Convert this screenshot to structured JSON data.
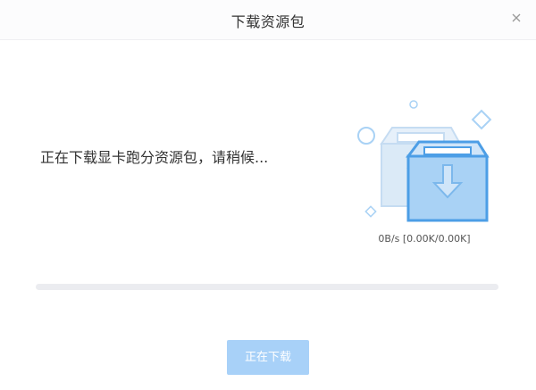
{
  "dialog": {
    "title": "下载资源包",
    "close_icon": "close-icon"
  },
  "status": {
    "message": "正在下载显卡跑分资源包，请稍候..."
  },
  "download": {
    "speed_text": "0B/s [0.00K/0.00K]",
    "progress_fraction": 0
  },
  "actions": {
    "primary_label": "正在下载",
    "primary_enabled": false
  },
  "colors": {
    "accent": "#4c9ee6",
    "button_disabled": "#a8d1f8",
    "progress_track": "#ebecf0",
    "illustration_front": "#a9d2f5",
    "illustration_back": "#d7e9f8"
  }
}
